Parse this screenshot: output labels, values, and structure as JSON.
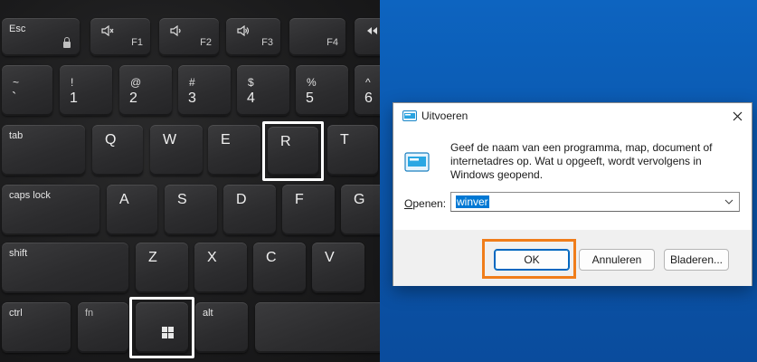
{
  "keyboard": {
    "keys": {
      "esc": "Esc",
      "f1": "F1",
      "f2": "F2",
      "f3": "F3",
      "f4": "F4",
      "tilde": "~",
      "backtick": "`",
      "excl": "!",
      "one": "1",
      "at": "@",
      "two": "2",
      "hash": "#",
      "three": "3",
      "dollar": "$",
      "four": "4",
      "percent": "%",
      "five": "5",
      "caret": "^",
      "six": "6",
      "tab": "tab",
      "q": "Q",
      "w": "W",
      "e": "E",
      "r": "R",
      "t": "T",
      "capslock": "caps lock",
      "a": "A",
      "s": "S",
      "d": "D",
      "f": "F",
      "g": "G",
      "shift": "shift",
      "z": "Z",
      "x": "X",
      "c": "C",
      "v": "V",
      "ctrl": "ctrl",
      "fn": "fn",
      "alt": "alt"
    },
    "icons": [
      "mute-icon",
      "volume-down-icon",
      "volume-up-icon",
      "lock-icon",
      "windows-logo-icon"
    ],
    "highlight_color": "#ffffff"
  },
  "dialog": {
    "title": "Uitvoeren",
    "description": "Geef de naam van een programma, map, document of internetadres op. Wat u opgeeft, wordt vervolgens in Windows geopend.",
    "open_label_accel": "O",
    "open_label_rest": "penen:",
    "open_value": "winver",
    "buttons": {
      "ok": "OK",
      "cancel": "Annuleren",
      "browse": "Bladeren..."
    },
    "highlight_color": "#f07d1a",
    "accent_color": "#0078d4"
  }
}
